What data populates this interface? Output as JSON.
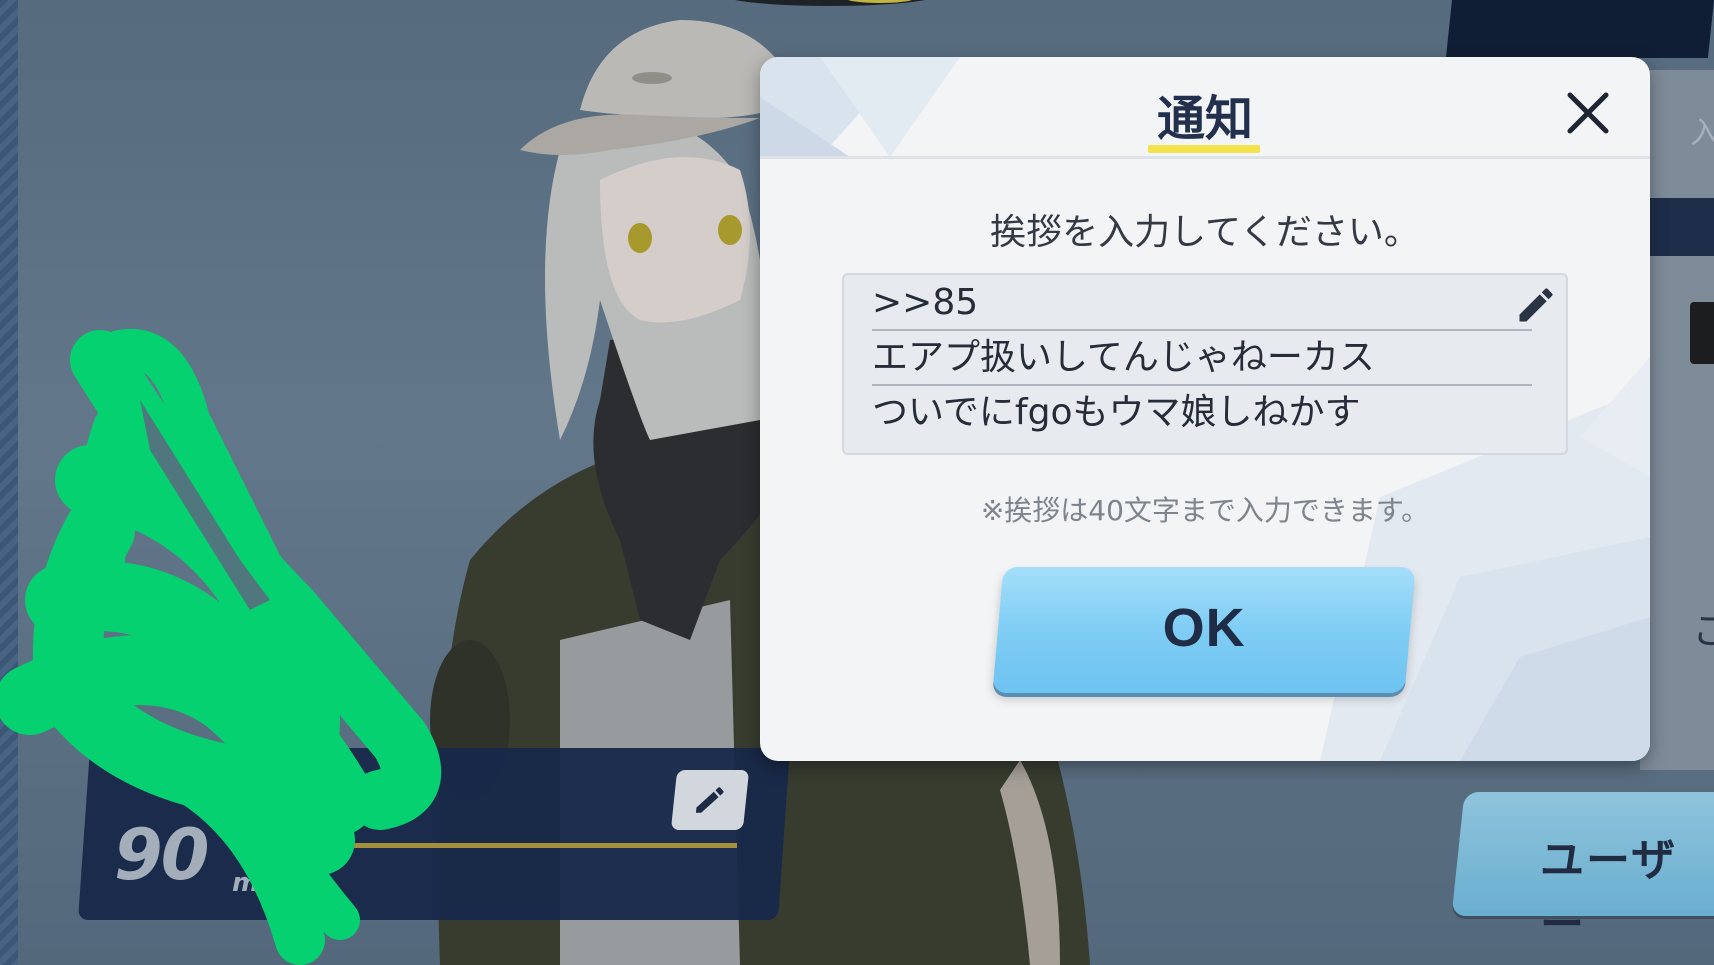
{
  "dialog": {
    "title": "通知",
    "instruction": "挨拶を入力してください。",
    "greeting_lines": [
      ">>85",
      "エアプ扱いしてんじゃねーカス",
      "ついでにfgoもウマ娘しねかす"
    ],
    "note": "※挨拶は40文字まで入力できます。",
    "ok_label": "OK"
  },
  "background": {
    "level_value": "90",
    "level_caption": "m",
    "user_button_label": "ユーザー",
    "right_glyph_top": "入",
    "right_glyph_bottom": "こ"
  },
  "colors": {
    "accent_underline": "#f2e34a",
    "ok_button": "#7fcdf5",
    "scribble": "#00e676",
    "panel_navy": "#15264a"
  },
  "icons": {
    "close": "close-icon",
    "edit_greeting": "pencil-icon",
    "edit_level": "pencil-icon"
  }
}
